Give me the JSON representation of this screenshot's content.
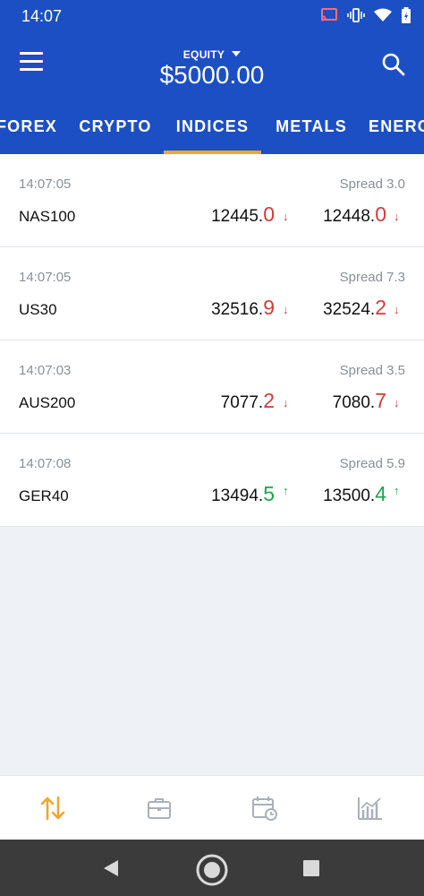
{
  "status_bar": {
    "time": "14:07"
  },
  "header": {
    "equity_label": "EQUITY",
    "equity_value": "$5000.00"
  },
  "tabs": [
    {
      "label": "FOREX",
      "active": false
    },
    {
      "label": "CRYPTO",
      "active": false
    },
    {
      "label": "INDICES",
      "active": true
    },
    {
      "label": "METALS",
      "active": false
    },
    {
      "label": "ENERGY",
      "active": false
    }
  ],
  "instruments": [
    {
      "time": "14:07:05",
      "spread": "Spread 3.0",
      "symbol": "NAS100",
      "bid_main": "12445.",
      "bid_last": "0",
      "bid_dir": "down",
      "ask_main": "12448.",
      "ask_last": "0",
      "ask_dir": "down"
    },
    {
      "time": "14:07:05",
      "spread": "Spread 7.3",
      "symbol": "US30",
      "bid_main": "32516.",
      "bid_last": "9",
      "bid_dir": "down",
      "ask_main": "32524.",
      "ask_last": "2",
      "ask_dir": "down"
    },
    {
      "time": "14:07:03",
      "spread": "Spread 3.5",
      "symbol": "AUS200",
      "bid_main": "7077.",
      "bid_last": "2",
      "bid_dir": "down",
      "ask_main": "7080.",
      "ask_last": "7",
      "ask_dir": "down"
    },
    {
      "time": "14:07:08",
      "spread": "Spread 5.9",
      "symbol": "GER40",
      "bid_main": "13494.",
      "bid_last": "5",
      "bid_dir": "up",
      "ask_main": "13500.",
      "ask_last": "4",
      "ask_dir": "up"
    }
  ],
  "arrows": {
    "down": "↓",
    "up": "↑"
  },
  "bottom_nav": [
    {
      "icon": "sort-arrows-icon",
      "active": true
    },
    {
      "icon": "briefcase-icon",
      "active": false
    },
    {
      "icon": "calendar-clock-icon",
      "active": false
    },
    {
      "icon": "bar-chart-icon",
      "active": false
    }
  ],
  "colors": {
    "header_bg": "#1d4fc4",
    "tab_indicator": "#f2a531",
    "price_down": "#d63a3a",
    "price_up": "#1aa64a",
    "nav_active": "#f2a531",
    "nav_inactive": "#a9b0bb"
  }
}
